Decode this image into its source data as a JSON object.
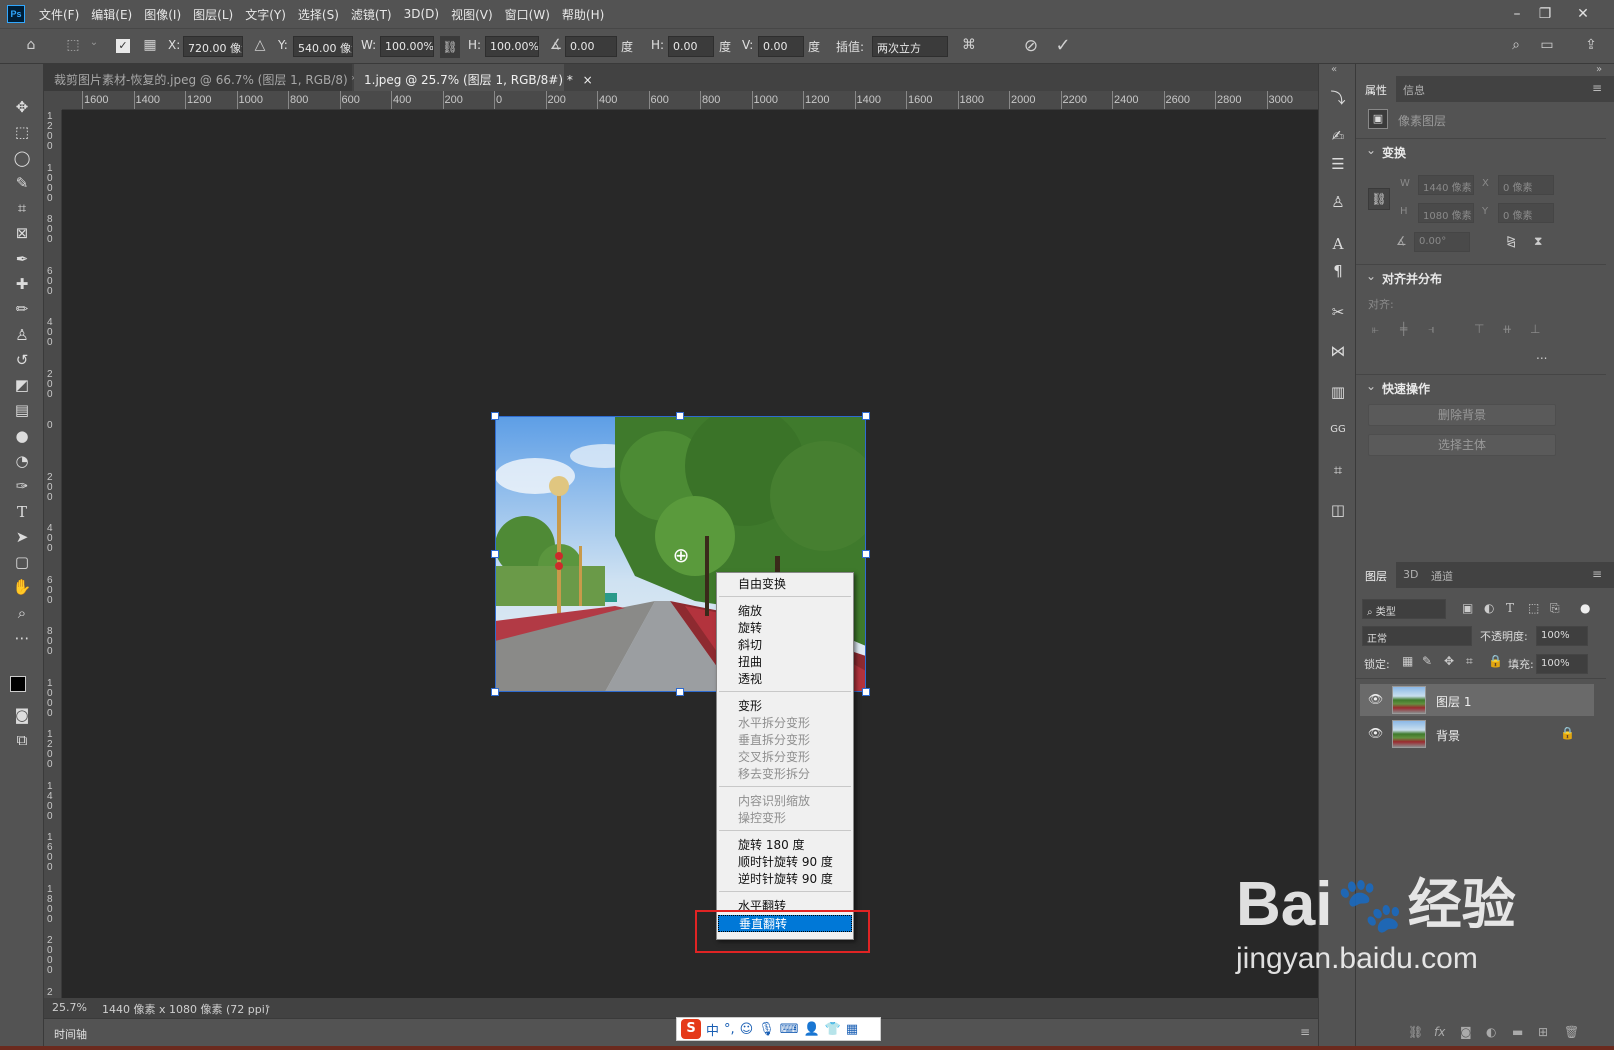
{
  "app": {
    "logo": "Ps",
    "menu": [
      "文件(F)",
      "编辑(E)",
      "图像(I)",
      "图层(L)",
      "文字(Y)",
      "选择(S)",
      "滤镜(T)",
      "3D(D)",
      "视图(V)",
      "窗口(W)",
      "帮助(H)"
    ]
  },
  "options": {
    "x_label": "X:",
    "x_value": "720.00 像素",
    "y_label": "Y:",
    "y_value": "540.00 像素",
    "w_label": "W:",
    "w_value": "100.00%",
    "h_label": "H:",
    "h_value": "100.00%",
    "angle_value": "0.00",
    "deg": "度",
    "hskew_label": "H:",
    "hskew_value": "0.00",
    "vskew_label": "V:",
    "vskew_value": "0.00",
    "interp_label": "插值:",
    "interp_value": "两次立方"
  },
  "tabs": [
    {
      "label": "裁剪图片素材-恢复的.jpeg @ 66.7% (图层 1, RGB/8) *",
      "close": "×"
    },
    {
      "label": "1.jpeg @ 25.7% (图层 1, RGB/8#) *",
      "close": "×"
    }
  ],
  "ruler_top": [
    "1600",
    "1400",
    "1200",
    "1000",
    "800",
    "600",
    "400",
    "200",
    "0",
    "200",
    "400",
    "600",
    "800",
    "1000",
    "1200",
    "1400",
    "1600",
    "1800",
    "2000",
    "2200",
    "2400",
    "2600",
    "2800",
    "3000"
  ],
  "ruler_left": [
    "1200",
    "1000",
    "800",
    "600",
    "400",
    "200",
    "0",
    "200",
    "400",
    "600",
    "800",
    "1000",
    "1200",
    "1400",
    "1600",
    "1800",
    "2000",
    "2200"
  ],
  "context_menu": {
    "items": [
      {
        "label": "自由变换",
        "enabled": true
      },
      {
        "label": "缩放",
        "enabled": true
      },
      {
        "label": "旋转",
        "enabled": true
      },
      {
        "label": "斜切",
        "enabled": true
      },
      {
        "label": "扭曲",
        "enabled": true
      },
      {
        "label": "透视",
        "enabled": true
      },
      {
        "label": "变形",
        "enabled": true
      },
      {
        "label": "水平拆分变形",
        "enabled": false
      },
      {
        "label": "垂直拆分变形",
        "enabled": false
      },
      {
        "label": "交叉拆分变形",
        "enabled": false
      },
      {
        "label": "移去变形拆分",
        "enabled": false
      },
      {
        "label": "内容识别缩放",
        "enabled": false
      },
      {
        "label": "操控变形",
        "enabled": false
      },
      {
        "label": "旋转 180 度",
        "enabled": true
      },
      {
        "label": "顺时针旋转 90 度",
        "enabled": true
      },
      {
        "label": "逆时针旋转 90 度",
        "enabled": true
      },
      {
        "label": "水平翻转",
        "enabled": true
      },
      {
        "label": "垂直翻转",
        "enabled": true,
        "selected": true
      }
    ]
  },
  "status": {
    "zoom": "25.7%",
    "doc_info": "1440 像素 x 1080 像素 (72 ppi)",
    "timeline": "时间轴"
  },
  "properties": {
    "tab_props": "属性",
    "tab_info": "信息",
    "layer_type": "像素图层",
    "transform_title": "变换",
    "w_label": "W",
    "w_value": "1440 像素",
    "x_label": "X",
    "x_value": "0 像素",
    "h_label": "H",
    "h_value": "1080 像素",
    "y_label": "Y",
    "y_value": "0 像素",
    "angle_value": "0.00°",
    "align_title": "对齐并分布",
    "align_label": "对齐:",
    "more": "...",
    "quick_title": "快速操作",
    "btn_remove_bg": "删除背景",
    "btn_select_subject": "选择主体"
  },
  "layers": {
    "tab_layers": "图层",
    "tab_3d": "3D",
    "tab_channels": "通道",
    "filter_kind": "类型",
    "blend_mode": "正常",
    "opacity_label": "不透明度:",
    "opacity_value": "100%",
    "lock_label": "锁定:",
    "fill_label": "填充:",
    "fill_value": "100%",
    "rows": [
      {
        "name": "图层 1",
        "selected": true
      },
      {
        "name": "背景",
        "selected": false
      }
    ]
  },
  "watermark": {
    "brand": "Bai",
    "brand2": "经验",
    "url": "jingyan.baidu.com"
  },
  "ime": {
    "label": "中"
  },
  "colors": {
    "accent_selected": "#0078d7",
    "highlight_box": "#e02424"
  }
}
